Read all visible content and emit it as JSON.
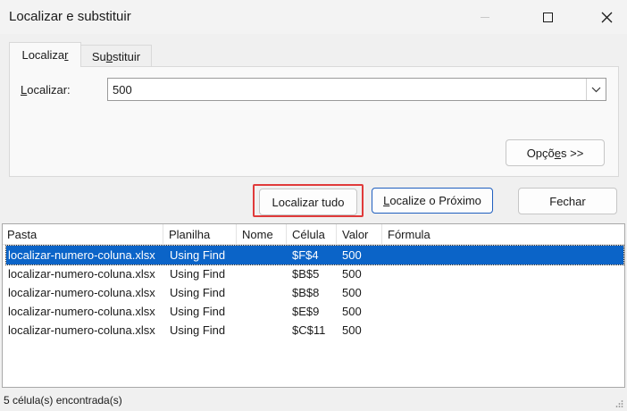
{
  "window": {
    "title": "Localizar e substituir"
  },
  "tabs": {
    "find_pre": "Localiza",
    "find_ul": "r",
    "replace_pre": "Su",
    "replace_ul": "b",
    "replace_post": "stituir"
  },
  "find": {
    "label_ul": "L",
    "label_rest": "ocalizar:",
    "value": "500"
  },
  "buttons": {
    "options_pre": "Opçõ",
    "options_ul": "e",
    "options_post": "s >>",
    "find_all": "Localizar tudo",
    "find_next_ul": "L",
    "find_next_rest": "ocalize o Próximo",
    "close": "Fechar"
  },
  "results": {
    "columns": [
      "Pasta",
      "Planilha",
      "Nome",
      "Célula",
      "Valor",
      "Fórmula"
    ],
    "rows": [
      {
        "pasta": "localizar-numero-coluna.xlsx",
        "planilha": "Using Find",
        "nome": "",
        "celula": "$F$4",
        "valor": "500",
        "formula": ""
      },
      {
        "pasta": "localizar-numero-coluna.xlsx",
        "planilha": "Using Find",
        "nome": "",
        "celula": "$B$5",
        "valor": "500",
        "formula": ""
      },
      {
        "pasta": "localizar-numero-coluna.xlsx",
        "planilha": "Using Find",
        "nome": "",
        "celula": "$B$8",
        "valor": "500",
        "formula": ""
      },
      {
        "pasta": "localizar-numero-coluna.xlsx",
        "planilha": "Using Find",
        "nome": "",
        "celula": "$E$9",
        "valor": "500",
        "formula": ""
      },
      {
        "pasta": "localizar-numero-coluna.xlsx",
        "planilha": "Using Find",
        "nome": "",
        "celula": "$C$11",
        "valor": "500",
        "formula": ""
      }
    ],
    "selected_row": 0
  },
  "status": {
    "text": "5 célula(s) encontrada(s)"
  },
  "colors": {
    "selection": "#0b64c8",
    "highlight_box": "#e03a3a",
    "default_button_border": "#1f5fbf"
  },
  "icons": [
    "minimize-icon",
    "maximize-icon",
    "close-icon",
    "chevron-down-icon",
    "resize-grip-icon"
  ]
}
